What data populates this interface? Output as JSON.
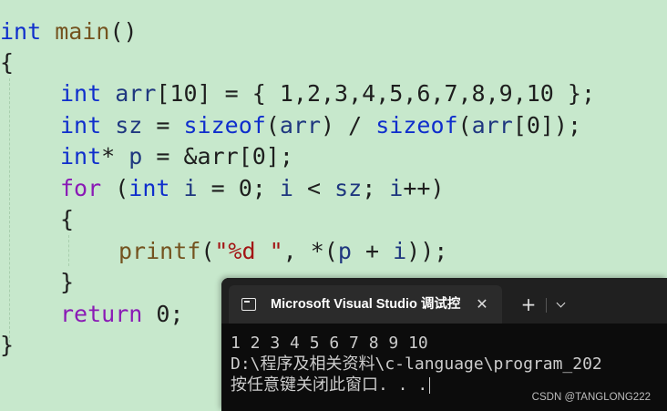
{
  "code": {
    "line1": {
      "type": "int",
      "name": "main",
      "paren": "()"
    },
    "line2": {
      "brace": "{"
    },
    "line3": {
      "type": "int",
      "var": "arr",
      "rest": "[10] = { 1,2,3,4,5,6,7,8,9,10 };"
    },
    "line4": {
      "type": "int",
      "var": "sz",
      "eq": " = ",
      "sizeof1": "sizeof",
      "p1": "(",
      "arg1": "arr",
      "p2": ") / ",
      "sizeof2": "sizeof",
      "p3": "(",
      "arg2": "arr",
      "p4": "[0]);"
    },
    "line5": {
      "type": "int",
      "star": "* ",
      "var": "p",
      "rest": " = &arr[0];"
    },
    "line6": {
      "kw": "for",
      "p1": " (",
      "type": "int",
      "sp": " ",
      "var": "i",
      "rest1": " = 0; ",
      "var2": "i",
      "rest2": " < ",
      "var3": "sz",
      "rest3": "; ",
      "var4": "i",
      "rest4": "++)"
    },
    "line7": {
      "brace": "{"
    },
    "line8": {
      "fn": "printf",
      "p1": "(",
      "str": "\"%d \"",
      "rest1": ", *(",
      "var": "p",
      "rest2": " + ",
      "var2": "i",
      "rest3": "));"
    },
    "line9": {
      "brace": "}"
    },
    "line10": {
      "kw": "return",
      "rest": " 0;"
    },
    "line11": {
      "brace": "}"
    }
  },
  "terminal": {
    "tab_title": "Microsoft Visual Studio 调试控",
    "close_glyph": "✕",
    "new_tab_glyph": "+",
    "output_line1": "1 2 3 4 5 6 7 8 9 10",
    "output_line2": "D:\\程序及相关资料\\c-language\\program_202",
    "output_line3": "按任意键关闭此窗口. . ."
  },
  "watermark": "CSDN @TANGLONG222"
}
